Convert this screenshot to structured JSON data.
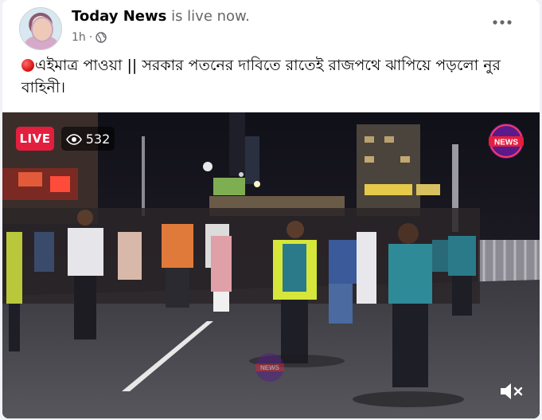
{
  "post": {
    "page_name": "Today News",
    "status": " is live now.",
    "time": "1h",
    "separator": "·",
    "privacy_icon": "globe-icon",
    "more_icon": "more-horizontal-icon",
    "caption": "এইমাত্র পাওয়া || সরকার পতনের দাবিতে রাতেই রাজপথে ঝাপিয়ে পড়লো নুর বাহিনী।",
    "caption_emoji": "red-circle-icon"
  },
  "video": {
    "live_label": "LIVE",
    "viewer_count": "532",
    "viewer_icon": "eye-icon",
    "channel_logo": "news-logo",
    "watermark": "news-watermark",
    "mute_icon": "speaker-muted-icon"
  },
  "colors": {
    "live_red": "#e41e3f",
    "brand_purple": "#5a1a8c",
    "text_primary": "#050505",
    "text_secondary": "#65676b"
  }
}
